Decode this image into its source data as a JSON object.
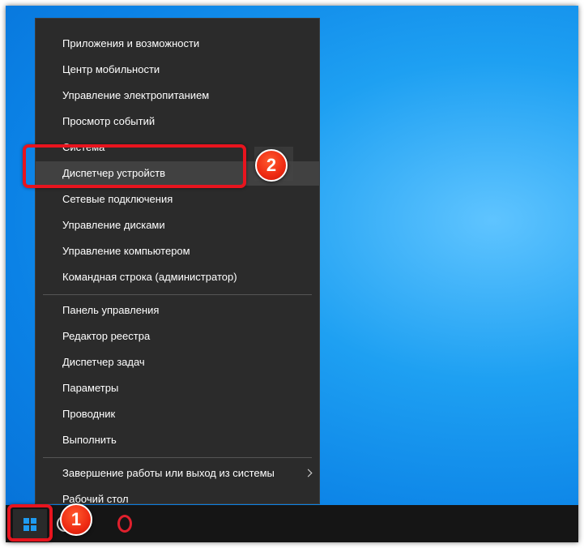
{
  "menu": {
    "items": [
      {
        "label": "Приложения и возможности"
      },
      {
        "label": "Центр мобильности"
      },
      {
        "label": "Управление электропитанием"
      },
      {
        "label": "Просмотр событий"
      },
      {
        "label": "Система"
      },
      {
        "label": "Диспетчер устройств"
      },
      {
        "label": "Сетевые подключения"
      },
      {
        "label": "Управление дисками"
      },
      {
        "label": "Управление компьютером"
      },
      {
        "label": "Командная строка (администратор)"
      },
      {
        "label": "Панель управления"
      },
      {
        "label": "Редактор реестра"
      },
      {
        "label": "Диспетчер задач"
      },
      {
        "label": "Параметры"
      },
      {
        "label": "Проводник"
      },
      {
        "label": "Выполнить"
      },
      {
        "label": "Завершение работы или выход из системы"
      },
      {
        "label": "Рабочий стол"
      }
    ]
  },
  "annotations": {
    "badge_1": "1",
    "badge_2": "2"
  },
  "colors": {
    "menu_bg": "#2b2b2b",
    "highlight_red": "#e8141e",
    "desktop_blue": "#0b82e6",
    "taskbar": "#151515"
  },
  "icons": {
    "start": "windows-logo-icon",
    "search": "search-icon",
    "browser": "opera-icon",
    "submenu": "chevron-right-icon"
  }
}
